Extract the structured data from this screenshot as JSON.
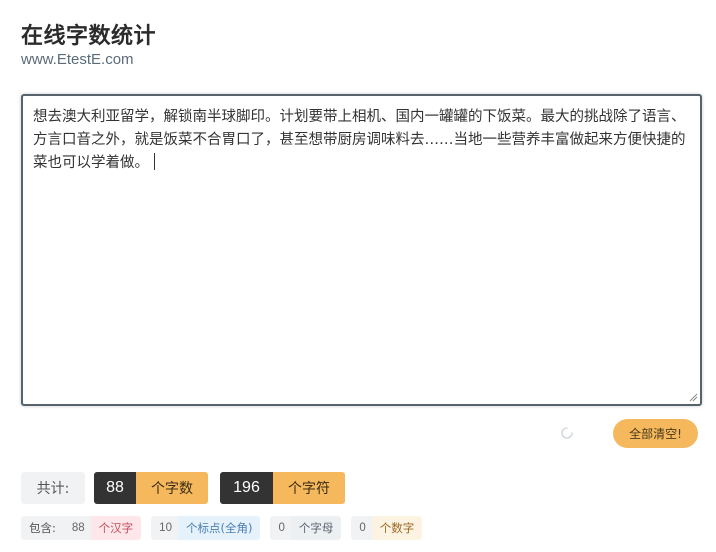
{
  "header": {
    "title": "在线字数统计",
    "url": "www.EtestE.com"
  },
  "editor": {
    "content": "想去澳大利亚留学，解锁南半球脚印。计划要带上相机、国内一罐罐的下饭菜。最大的挑战除了语言、方言口音之外，就是饭菜不合胃口了，甚至想带厨房调味料去……当地一些营养丰富做起来方便快捷的菜也可以学着做。"
  },
  "actions": {
    "clear_label": "全部清空!"
  },
  "summary": {
    "label": "共计:",
    "chars_count": "88",
    "chars_unit": "个字数",
    "symbols_count": "196",
    "symbols_unit": "个字符"
  },
  "details": {
    "label": "包含:",
    "hanzi_count": "88",
    "hanzi_unit": "个汉字",
    "punct_count": "10",
    "punct_unit": "个标点(全角)",
    "letter_count": "0",
    "letter_unit": "个字母",
    "digit_count": "0",
    "digit_unit": "个数字"
  },
  "colors": {
    "accent": "#f5b85c",
    "dark": "#333333",
    "border": "#56636c"
  },
  "icons": {
    "loading": "spinner-icon",
    "resize": "resize-grip-icon"
  }
}
